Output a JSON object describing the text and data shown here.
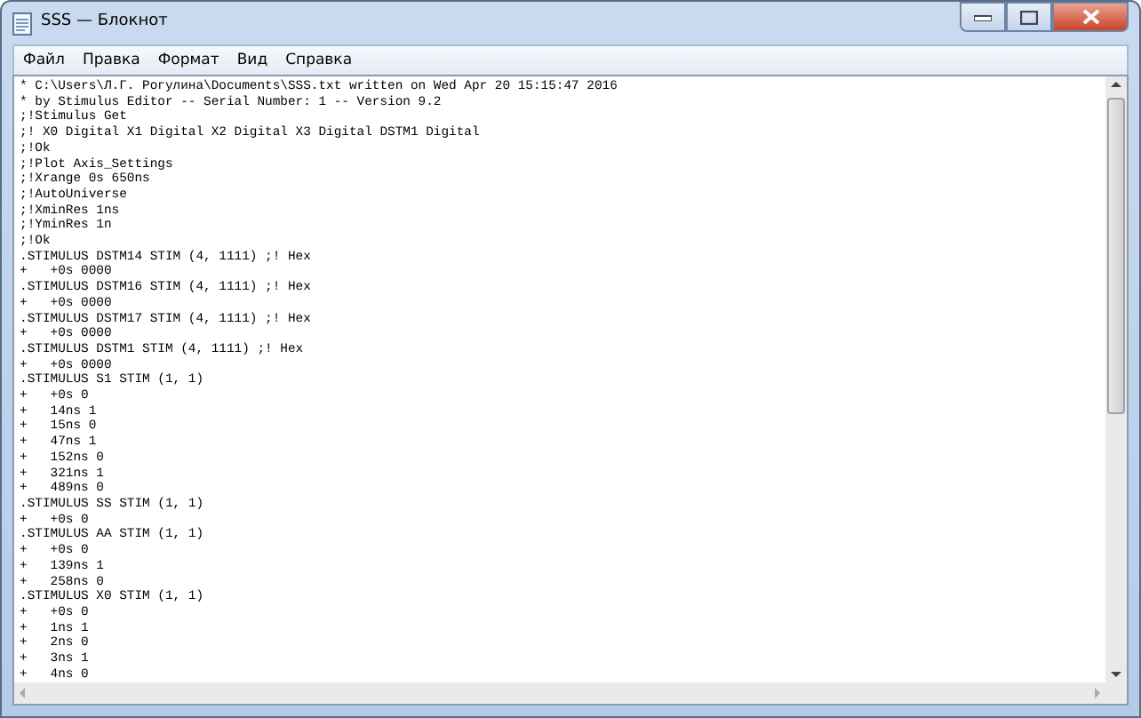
{
  "window": {
    "title": "SSS — Блокнот"
  },
  "menu": [
    "Файл",
    "Правка",
    "Формат",
    "Вид",
    "Справка"
  ],
  "lines": [
    "* C:\\Users\\Л.Г. Рогулина\\Documents\\SSS.txt written on Wed Apr 20 15:15:47 2016",
    "* by Stimulus Editor -- Serial Number: 1 -- Version 9.2",
    ";!Stimulus Get",
    ";! X0 Digital X1 Digital X2 Digital X3 Digital DSTM1 Digital",
    ";!Ok",
    ";!Plot Axis_Settings",
    ";!Xrange 0s 650ns",
    ";!AutoUniverse",
    ";!XminRes 1ns",
    ";!YminRes 1n",
    ";!Ok",
    ".STIMULUS DSTM14 STIM (4, 1111) ;! Hex",
    "+   +0s 0000",
    ".STIMULUS DSTM16 STIM (4, 1111) ;! Hex",
    "+   +0s 0000",
    ".STIMULUS DSTM17 STIM (4, 1111) ;! Hex",
    "+   +0s 0000",
    ".STIMULUS DSTM1 STIM (4, 1111) ;! Hex",
    "+   +0s 0000",
    ".STIMULUS S1 STIM (1, 1)",
    "+   +0s 0",
    "+   14ns 1",
    "+   15ns 0",
    "+   47ns 1",
    "+   152ns 0",
    "+   321ns 1",
    "+   489ns 0",
    ".STIMULUS SS STIM (1, 1)",
    "+   +0s 0",
    ".STIMULUS AA STIM (1, 1)",
    "+   +0s 0",
    "+   139ns 1",
    "+   258ns 0",
    ".STIMULUS X0 STIM (1, 1)",
    "+   +0s 0",
    "+   1ns 1",
    "+   2ns 0",
    "+   3ns 1",
    "+   4ns 0"
  ]
}
